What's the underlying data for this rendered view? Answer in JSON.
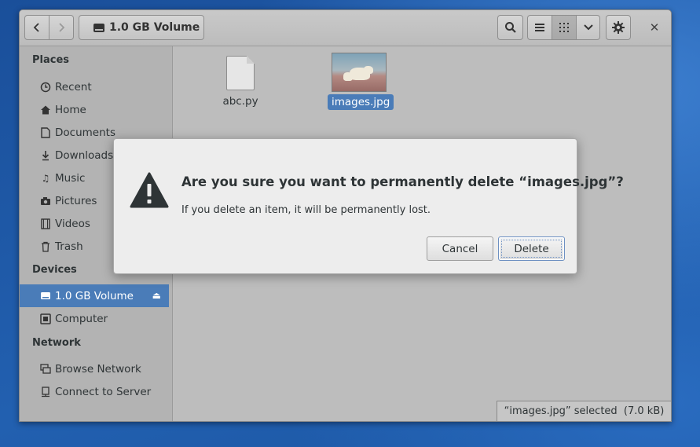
{
  "header": {
    "location_label": "1.0 GB Volume",
    "icons": [
      "go-back-icon",
      "go-forward-icon",
      "drive-icon",
      "search-icon",
      "list-view-icon",
      "grid-view-icon",
      "chevron-down-icon",
      "gear-icon",
      "close-icon"
    ]
  },
  "sidebar": {
    "places_heading": "Places",
    "places": [
      {
        "label": "Recent",
        "icon": "clock-icon"
      },
      {
        "label": "Home",
        "icon": "home-icon"
      },
      {
        "label": "Documents",
        "icon": "document-icon"
      },
      {
        "label": "Downloads",
        "icon": "download-icon"
      },
      {
        "label": "Music",
        "icon": "music-icon"
      },
      {
        "label": "Pictures",
        "icon": "camera-icon"
      },
      {
        "label": "Videos",
        "icon": "film-icon"
      },
      {
        "label": "Trash",
        "icon": "trash-icon"
      }
    ],
    "devices_heading": "Devices",
    "devices": [
      {
        "label": "1.0 GB Volume",
        "icon": "drive-icon",
        "active": true
      },
      {
        "label": "Computer",
        "icon": "computer-icon"
      }
    ],
    "network_heading": "Network",
    "network": [
      {
        "label": "Browse Network",
        "icon": "network-icon"
      },
      {
        "label": "Connect to Server",
        "icon": "server-icon"
      }
    ]
  },
  "files": [
    {
      "name": "abc.py",
      "type": "text"
    },
    {
      "name": "images.jpg",
      "type": "image",
      "selected": true
    }
  ],
  "status": {
    "text": "“images.jpg” selected  (7.0 kB)"
  },
  "dialog": {
    "title": "Are you sure you want to permanently delete “images.jpg”?",
    "message": "If you delete an item, it will be permanently lost.",
    "cancel_label": "Cancel",
    "delete_label": "Delete",
    "icon": "warning-icon"
  },
  "colors": {
    "selection": "#4a7cb8",
    "window_bg": "#bdbdbd",
    "desktop": "#1d5aa8"
  }
}
